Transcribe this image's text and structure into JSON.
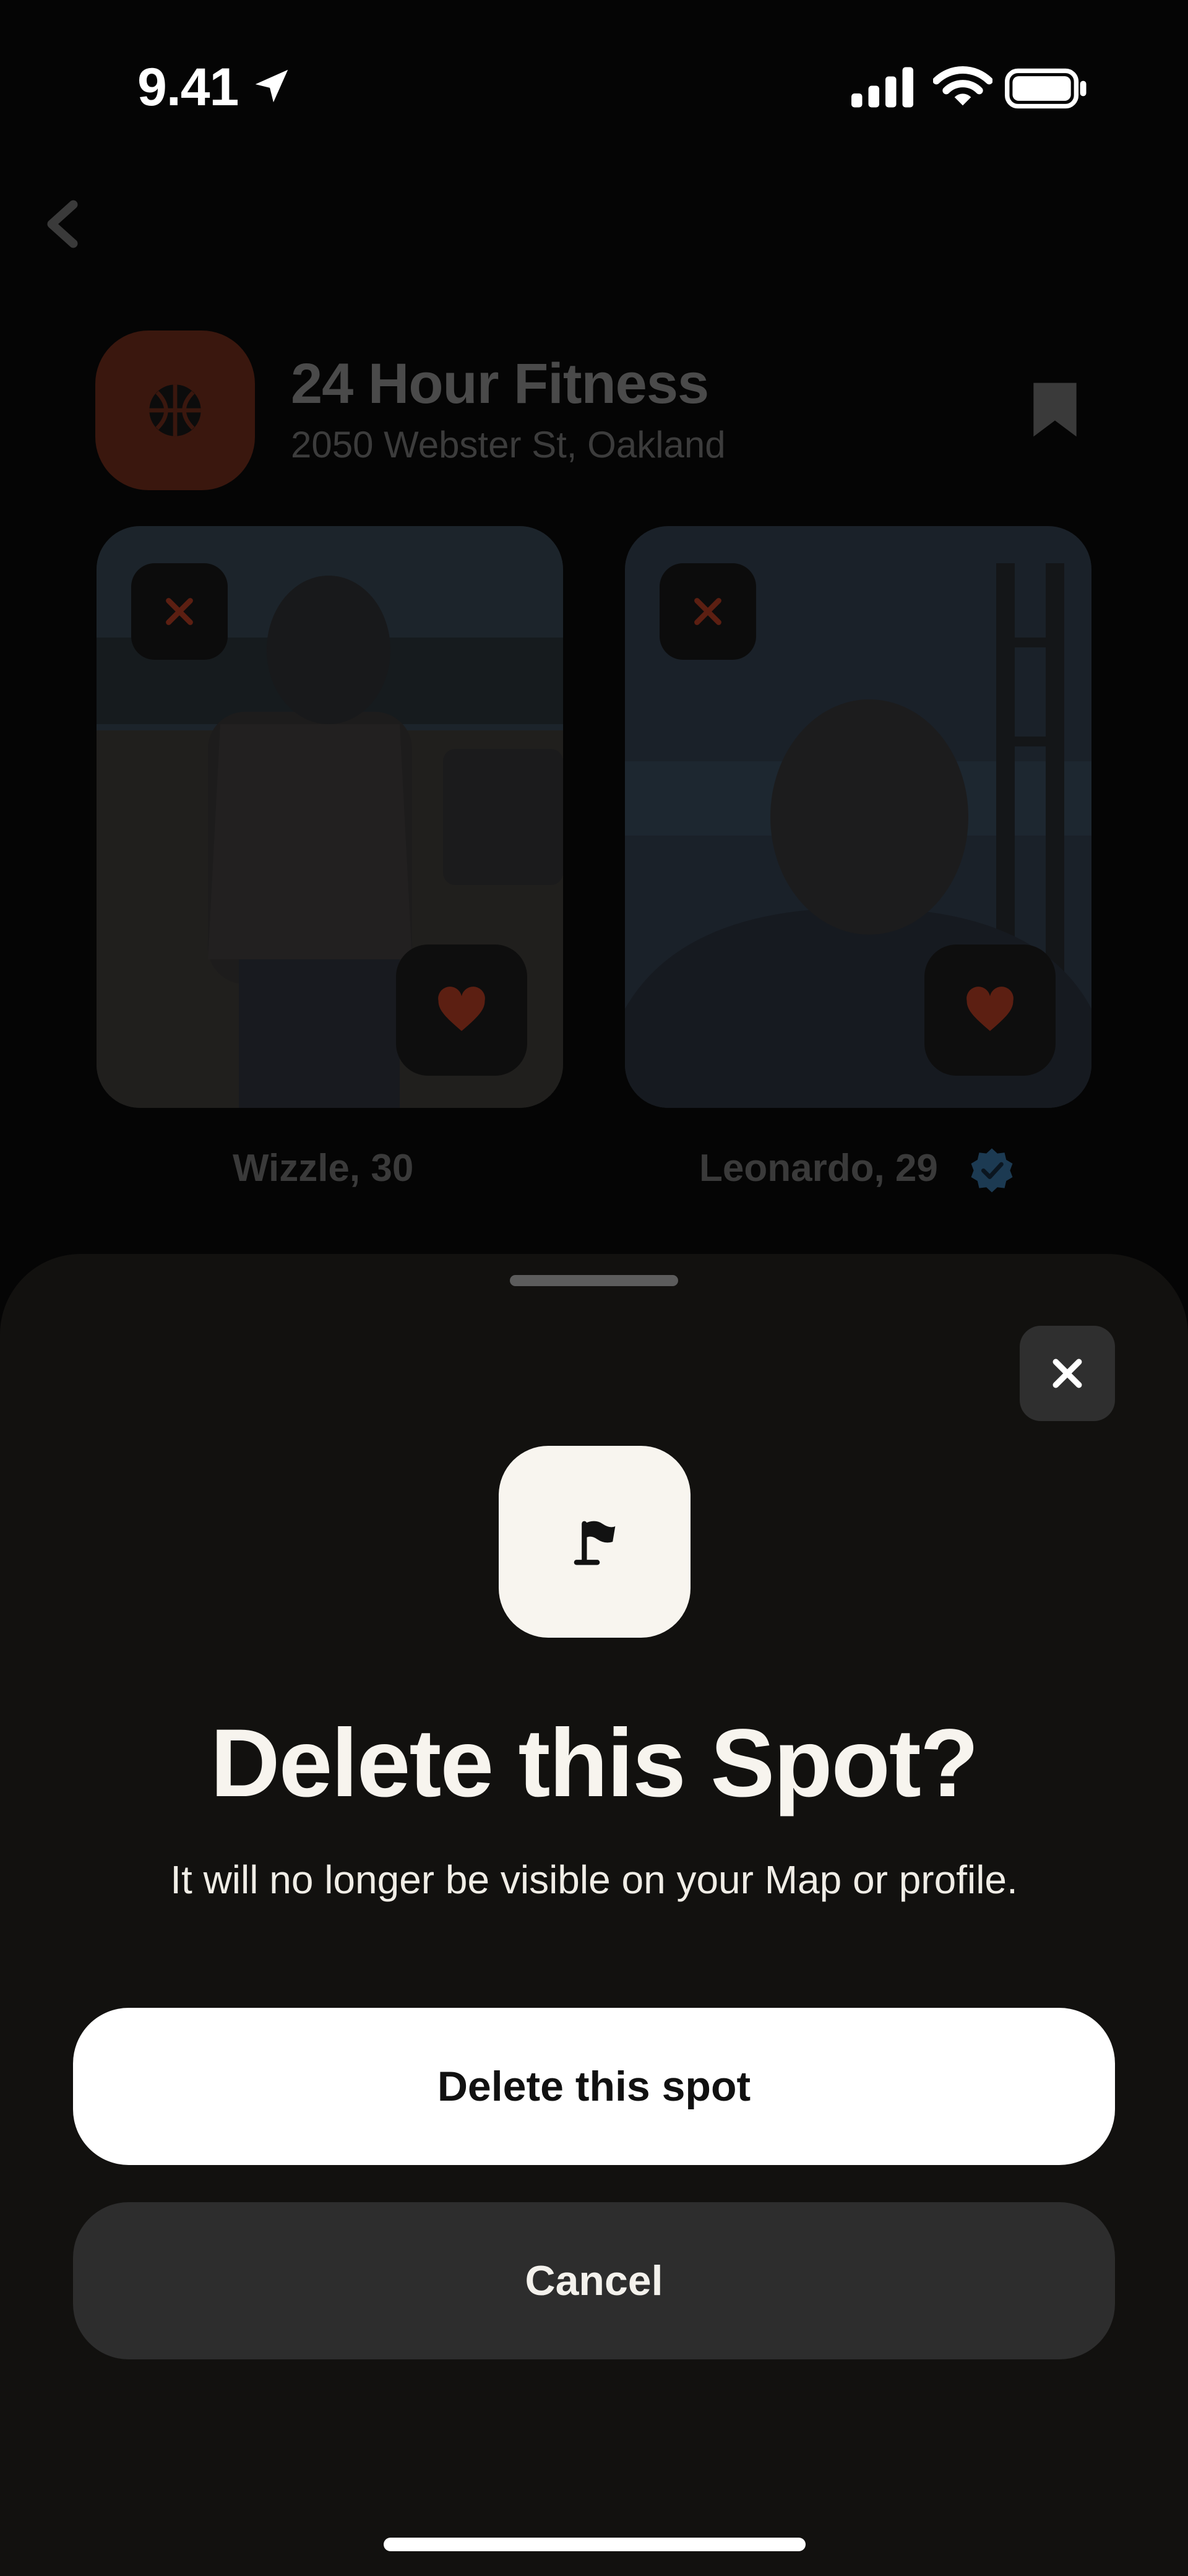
{
  "status_bar": {
    "time": "9.41",
    "location_icon": "location-arrow-icon",
    "signal_icon": "cellular-signal-icon",
    "wifi_icon": "wifi-icon",
    "battery_icon": "battery-full-icon"
  },
  "spot": {
    "name": "24 Hour Fitness",
    "address": "2050 Webster St, Oakland",
    "icon": "basketball-icon",
    "icon_bg_color": "#3a170e",
    "bookmark_icon": "bookmark-icon"
  },
  "people": [
    {
      "name_age": "Wizzle, 30",
      "verified": false
    },
    {
      "name_age": "Leonardo, 29",
      "verified": true
    }
  ],
  "dialog": {
    "icon": "flag-icon",
    "title": "Delete this Spot?",
    "subtitle": "It will no longer be visible on your Map or profile.",
    "primary_button": "Delete this spot",
    "secondary_button": "Cancel",
    "close_icon": "close-icon"
  },
  "colors": {
    "accent_red": "#c4442a",
    "sheet_background": "#12110f",
    "primary_button_bg": "#ffffff",
    "secondary_button_bg": "#2d2d2d"
  }
}
